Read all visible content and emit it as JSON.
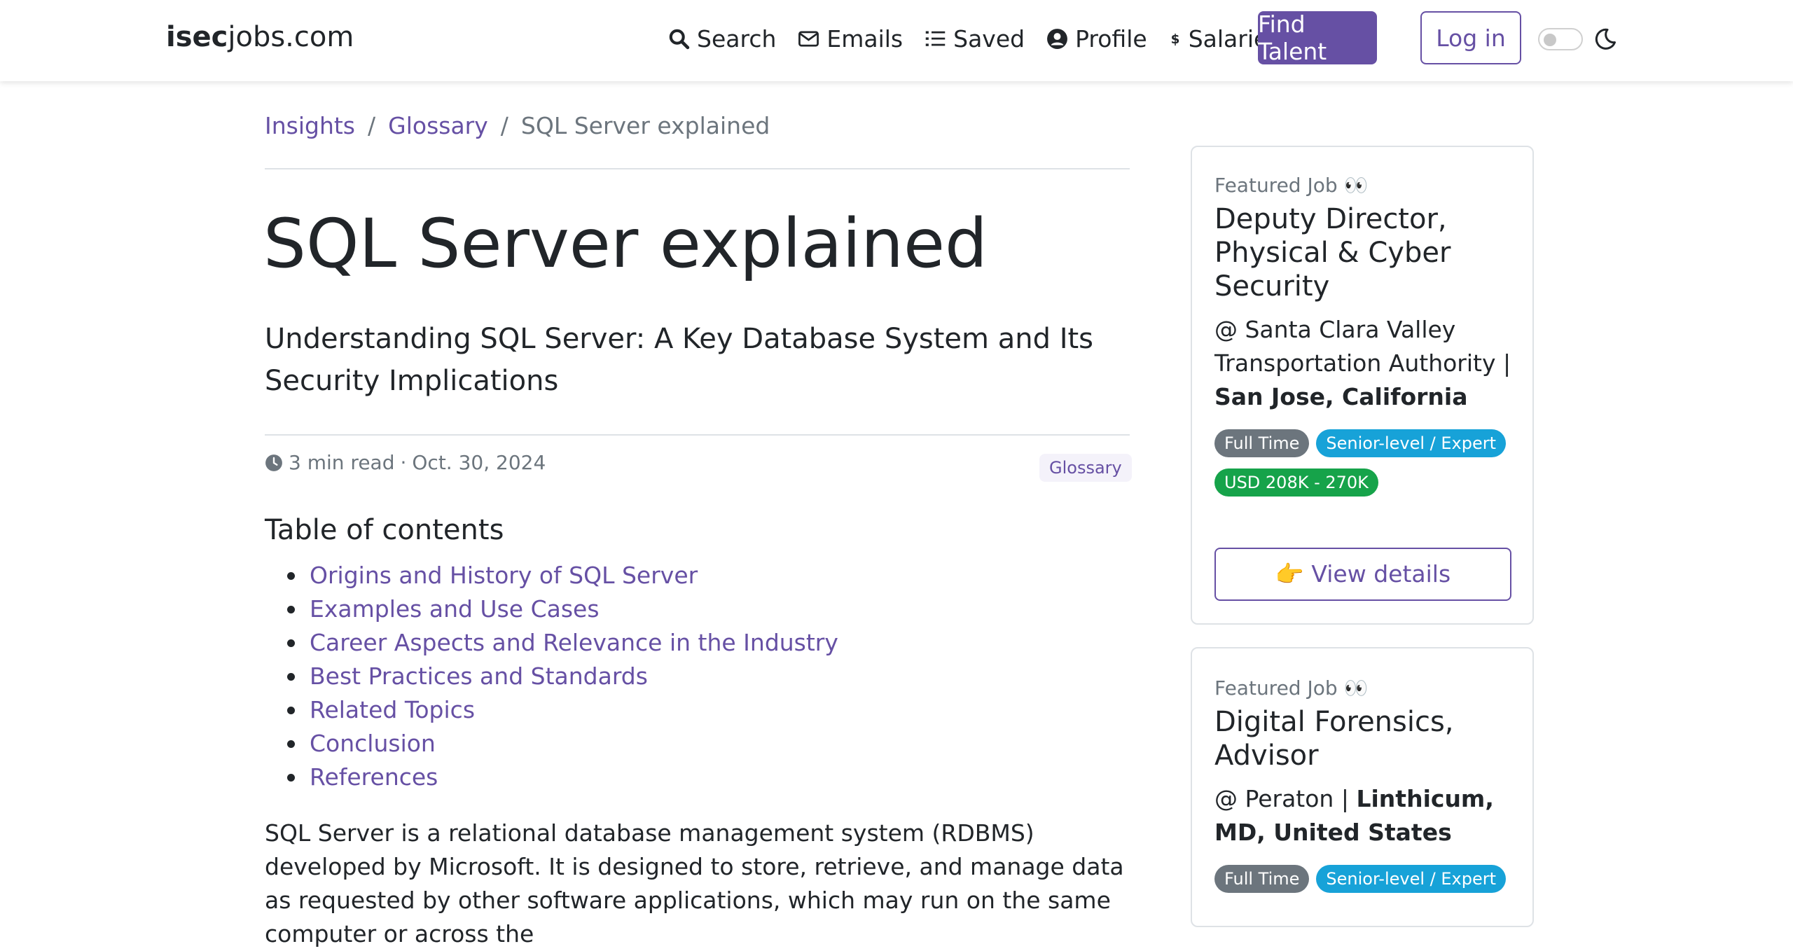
{
  "brand": {
    "bold": "isec",
    "rest": "jobs.com"
  },
  "nav": [
    {
      "label": "Search",
      "icon": "search-icon"
    },
    {
      "label": "Emails",
      "icon": "envelope-icon"
    },
    {
      "label": "Saved",
      "icon": "list-icon"
    },
    {
      "label": "Profile",
      "icon": "user-circle-icon"
    },
    {
      "label": "Salaries",
      "icon": "dollar-icon"
    }
  ],
  "buttons": {
    "find_talent": "Find Talent",
    "login": "Log in"
  },
  "colors": {
    "accent": "#6650a4",
    "badge_gray": "#6c757d",
    "badge_blue": "#17a2d8",
    "badge_green": "#16a34a"
  },
  "breadcrumb": {
    "items": [
      "Insights",
      "Glossary",
      "SQL Server explained"
    ],
    "separator": "/"
  },
  "article": {
    "title": "SQL Server explained",
    "subtitle": "Understanding SQL Server: A Key Database System and Its Security Implications",
    "read_time": "3 min read",
    "dot": "·",
    "date": "Oct. 30, 2024",
    "tag": "Glossary",
    "toc_title": "Table of contents",
    "toc": [
      "Origins and History of SQL Server",
      "Examples and Use Cases",
      "Career Aspects and Relevance in the Industry",
      "Best Practices and Standards",
      "Related Topics",
      "Conclusion",
      "References"
    ],
    "body": "SQL Server is a relational database management system (RDBMS) developed by Microsoft. It is designed to store, retrieve, and manage data as requested by other software applications, which may run on the same computer or across the"
  },
  "jobs": [
    {
      "featured": "Featured Job 👀",
      "title": "Deputy Director, Physical & Cyber Security",
      "company": "@ Santa Clara Valley Transportation Authority |",
      "location": "San Jose, California",
      "badges": [
        "Full Time",
        "Senior-level / Expert",
        "USD 208K - 270K"
      ],
      "cta": "👉 View details"
    },
    {
      "featured": "Featured Job 👀",
      "title": "Digital Forensics, Advisor",
      "company": "@ Peraton |",
      "location": "Linthicum, MD, United States",
      "badges": [
        "Full Time",
        "Senior-level / Expert"
      ]
    }
  ]
}
